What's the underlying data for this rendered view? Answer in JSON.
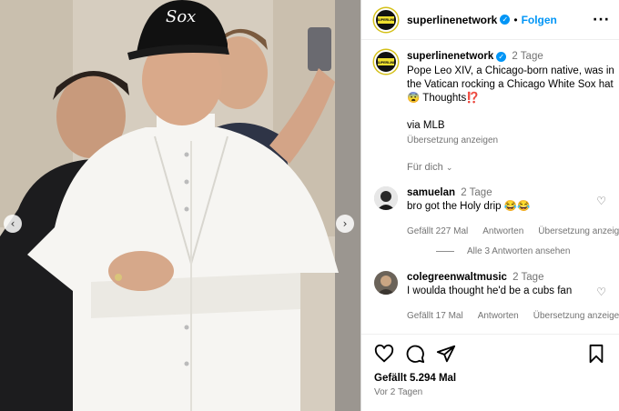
{
  "post": {
    "account": "superlinenetwork",
    "follow_label": "Folgen",
    "more_label": "···",
    "avatar_logo_text": "SUPERLINE"
  },
  "caption": {
    "username": "superlinenetwork",
    "time": "2 Tage",
    "text": "Pope Leo XIV, a Chicago-born native, was in the Vatican rocking a Chicago White Sox hat 😨 Thoughts⁉️",
    "via": "via MLB",
    "translate": "Übersetzung anzeigen",
    "for_you": "Für dich"
  },
  "comments": [
    {
      "username": "samuelan",
      "time": "2 Tage",
      "text": "bro got the Holy drip 😂😂",
      "likes": "Gefällt 227 Mal",
      "reply": "Antworten",
      "translate": "Übersetzung anzeigen"
    },
    {
      "username": "colegreenwaltmusic",
      "time": "2 Tage",
      "text": "I woulda thought he'd be a cubs fan",
      "likes": "Gefällt 17 Mal",
      "reply": "Antworten",
      "translate": "Übersetzung anzeigen"
    }
  ],
  "view_replies": "Alle 3 Antworten ansehen",
  "footer": {
    "likes": "Gefällt 5.294 Mal",
    "date": "Vor 2 Tagen"
  },
  "photo": {
    "hat_logo": "Sox",
    "carousel_prev": "‹",
    "carousel_next": "›"
  },
  "icons": [
    "heart-icon",
    "comment-icon",
    "share-icon",
    "bookmark-icon",
    "verified-icon",
    "chevron-down-icon",
    "more-icon"
  ],
  "colors": {
    "link": "#0095f6",
    "muted": "#737373",
    "border": "#dbdbdb"
  }
}
